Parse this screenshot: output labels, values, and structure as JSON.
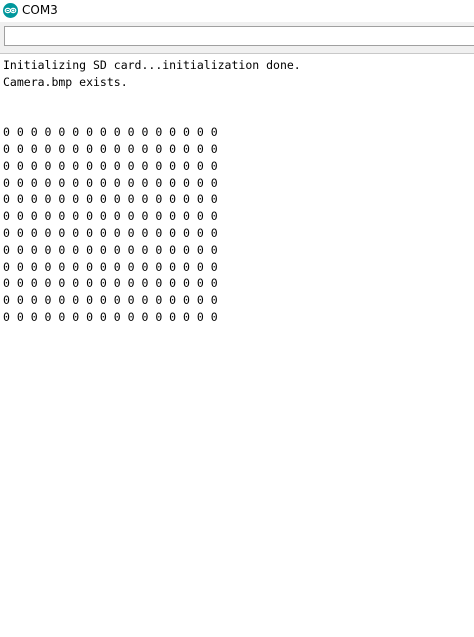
{
  "window": {
    "title": "COM3",
    "icon": "arduino-icon"
  },
  "send_bar": {
    "input_value": ""
  },
  "output": {
    "lines": [
      "Initializing SD card...initialization done.",
      "Camera.bmp exists.",
      "",
      "",
      "0 0 0 0 0 0 0 0 0 0 0 0 0 0 0 0",
      "0 0 0 0 0 0 0 0 0 0 0 0 0 0 0 0",
      "0 0 0 0 0 0 0 0 0 0 0 0 0 0 0 0",
      "0 0 0 0 0 0 0 0 0 0 0 0 0 0 0 0",
      "0 0 0 0 0 0 0 0 0 0 0 0 0 0 0 0",
      "0 0 0 0 0 0 0 0 0 0 0 0 0 0 0 0",
      "0 0 0 0 0 0 0 0 0 0 0 0 0 0 0 0",
      "0 0 0 0 0 0 0 0 0 0 0 0 0 0 0 0",
      "0 0 0 0 0 0 0 0 0 0 0 0 0 0 0 0",
      "0 0 0 0 0 0 0 0 0 0 0 0 0 0 0 0",
      "0 0 0 0 0 0 0 0 0 0 0 0 0 0 0 0",
      "0 0 0 0 0 0 0 0 0 0 0 0 0 0 0 0"
    ]
  },
  "colors": {
    "icon": "#00979c"
  }
}
